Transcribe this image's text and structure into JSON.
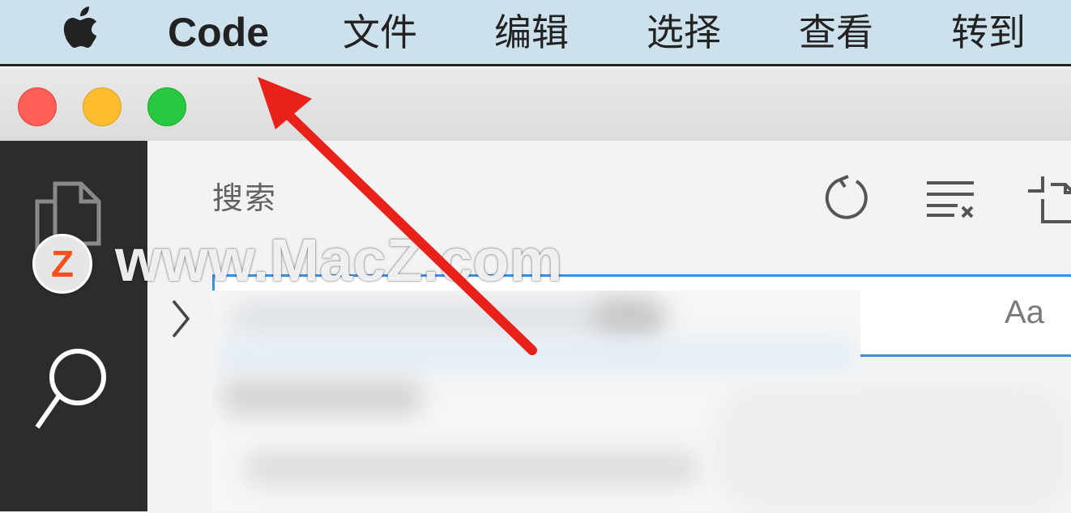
{
  "menubar": {
    "app_name": "Code",
    "items": [
      "文件",
      "编辑",
      "选择",
      "查看",
      "转到"
    ]
  },
  "sidebar": {
    "title": "搜索",
    "search_placeholder": "",
    "match_case_label": "Aa"
  },
  "watermark": {
    "logo_letter": "Z",
    "text": "www.MacZ.com"
  },
  "icons": {
    "apple": "apple-icon",
    "explorer": "files-icon",
    "search": "search-icon",
    "refresh": "refresh-icon",
    "clear": "clear-results-icon",
    "collapse": "new-search-editor-icon",
    "expand": "chevron-right-icon"
  },
  "colors": {
    "menubar_bg": "#cde1ec",
    "activitybar_bg": "#2c2c2c",
    "focus_border": "#3a8ee6",
    "annotation_arrow": "#e8211b",
    "close": "#fe5f57",
    "minimize": "#febc2e",
    "zoom": "#28c840"
  }
}
